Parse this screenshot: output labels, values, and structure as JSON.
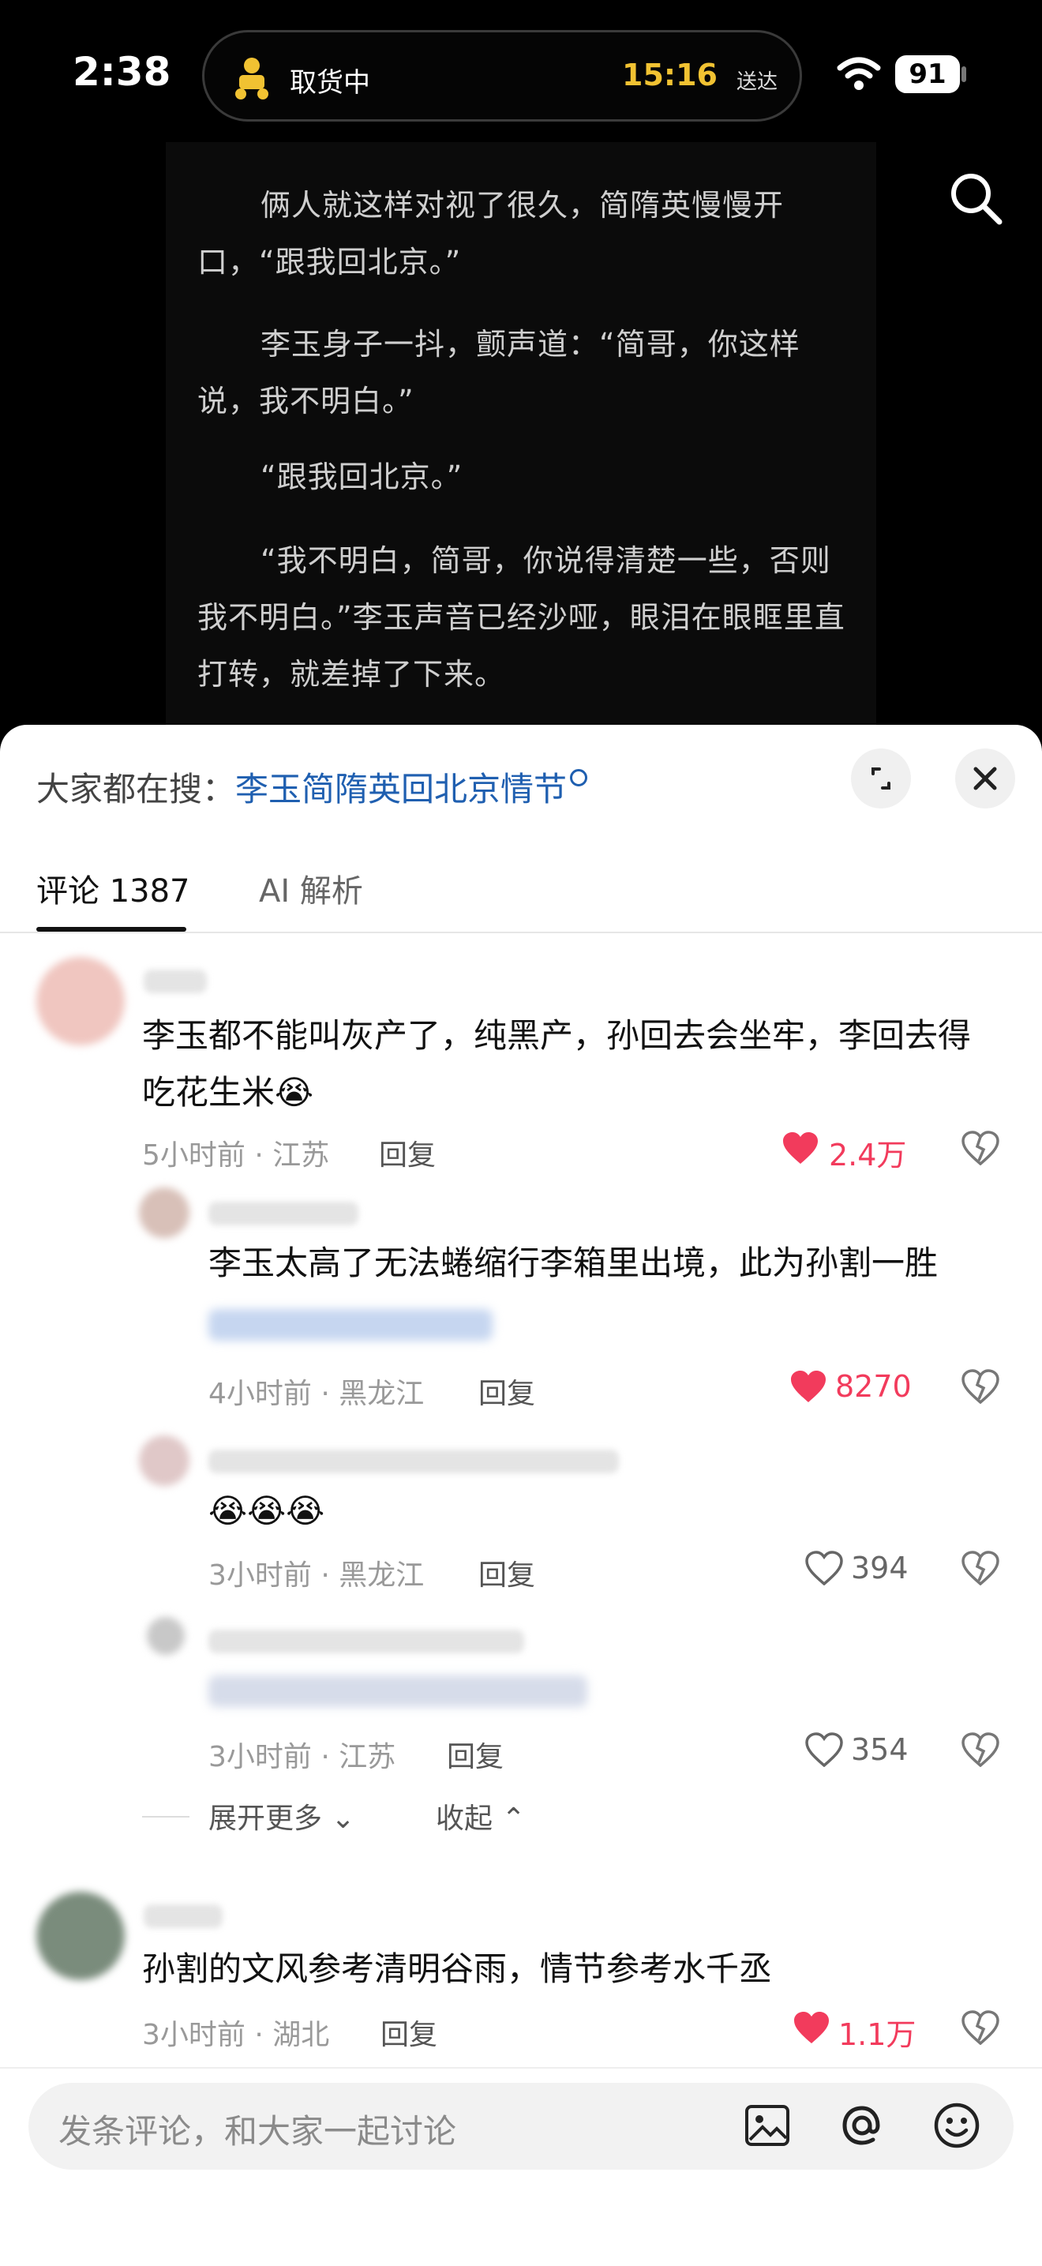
{
  "status": {
    "time": "2:38",
    "order_status": "取货中",
    "eta_time": "15:16",
    "eta_label": "送达",
    "battery": "91"
  },
  "reader": {
    "paragraphs": [
      "俩人就这样对视了很久，简隋英慢慢开口，“跟我回北京。”",
      "李玉身子一抖，颤声道：“简哥，你这样说，我不明白。”",
      "“跟我回北京。”",
      "“我不明白，简哥，你说得清楚一些，否则我不明白。”李玉声音已经沙哑，眼泪在眼眶里直打转，就差掉了下来。"
    ]
  },
  "sheet": {
    "trending_label": "大家都在搜：",
    "trending_query": "李玉简隋英回北京情节",
    "tabs": {
      "comments": "评论 1387",
      "ai": "AI 解析"
    }
  },
  "comments": [
    {
      "text": "李玉都不能叫灰产了，纯黑产，孙回去会坐牢，李回去得吃花生米😭",
      "meta": "5小时前 · 江苏",
      "reply": "回复",
      "likes": "2.4万",
      "liked": true
    },
    {
      "text": "李玉太高了无法蜷缩行李箱里出境，此为孙割一胜",
      "meta": "4小时前 · 黑龙江",
      "reply": "回复",
      "likes": "8270",
      "liked": true
    },
    {
      "text": "😭😭😭",
      "meta": "3小时前 · 黑龙江",
      "reply": "回复",
      "likes": "394",
      "liked": false
    },
    {
      "text": "",
      "meta": "3小时前 · 江苏",
      "reply": "回复",
      "likes": "354",
      "liked": false
    },
    {
      "text": "孙割的文风参考清明谷雨，情节参考水千丞",
      "meta": "3小时前 · 湖北",
      "reply": "回复",
      "likes": "1.1万",
      "liked": true
    }
  ],
  "thread_controls": {
    "expand": "展开更多",
    "collapse": "收起"
  },
  "input": {
    "placeholder": "发条评论，和大家一起讨论"
  },
  "colors": {
    "like_red": "#f23b5c",
    "link_blue": "#1f5fb0",
    "eta_yellow": "#f1c232"
  }
}
